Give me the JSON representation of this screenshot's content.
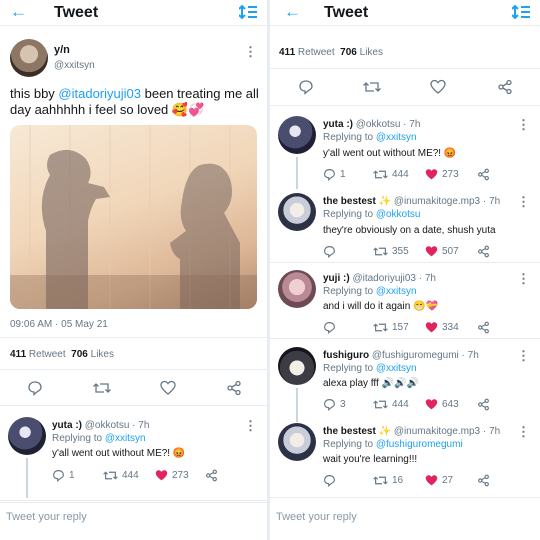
{
  "left": {
    "header": {
      "title": "Tweet"
    },
    "tweet": {
      "name": "y/n",
      "handle": "@xxitsyn",
      "text_pre": "this bby ",
      "mention": "@itadoriyuji03",
      "text_post": " been treating me all day aahhhhh i feel so loved 🥰💞",
      "timestamp": "09:06 AM · 05 May 21",
      "retweets": "411",
      "retweets_label": "Retweet",
      "likes": "706",
      "likes_label": "Likes"
    },
    "reply1": {
      "name": "yuta :)",
      "handle": "@okkotsu · 7h",
      "replying_label": "Replying to",
      "replying_to": "@xxitsyn",
      "text": "y'all went out without ME?! 😡",
      "comments": "1",
      "retweets": "444",
      "likes": "273"
    },
    "reply_placeholder": "Tweet your reply"
  },
  "right": {
    "header": {
      "title": "Tweet"
    },
    "stats": {
      "retweets": "411",
      "retweets_label": "Retweet",
      "likes": "706",
      "likes_label": "Likes"
    },
    "replies": [
      {
        "name": "yuta :)",
        "handle": "@okkotsu · 7h",
        "replying_label": "Replying to",
        "replying_to": "@xxitsyn",
        "text": "y'all went out without ME?! 😡",
        "comments": "1",
        "retweets": "444",
        "likes": "273"
      },
      {
        "name": "the bestest ✨",
        "handle": "@inumakitoge.mp3 · 7h",
        "replying_label": "Replying to",
        "replying_to": "@okkotsu",
        "text": "they're obviously on a date, shush yuta",
        "comments": "",
        "retweets": "355",
        "likes": "507"
      },
      {
        "name": "yuji :)",
        "handle": "@itadoriyuji03 · 7h",
        "replying_label": "Replying to",
        "replying_to": "@xxitsyn",
        "text": "and i will do it again 😁💝",
        "comments": "",
        "retweets": "157",
        "likes": "334"
      },
      {
        "name": "fushiguro",
        "handle": "@fushiguromegumi · 7h",
        "replying_label": "Replying to",
        "replying_to": "@xxitsyn",
        "text": "alexa play fff 🔊🔊🔊",
        "comments": "3",
        "retweets": "444",
        "likes": "643"
      },
      {
        "name": "the bestest ✨",
        "handle": "@inumakitoge.mp3 · 7h",
        "replying_label": "Replying to",
        "replying_to": "@fushiguromegumi",
        "text": "wait you're learning!!!",
        "comments": "",
        "retweets": "16",
        "likes": "27"
      }
    ],
    "reply_placeholder": "Tweet your reply"
  },
  "colors": {
    "accent": "#1da1f2",
    "like": "#e0245e",
    "text": "#14171a",
    "muted": "#657786"
  }
}
